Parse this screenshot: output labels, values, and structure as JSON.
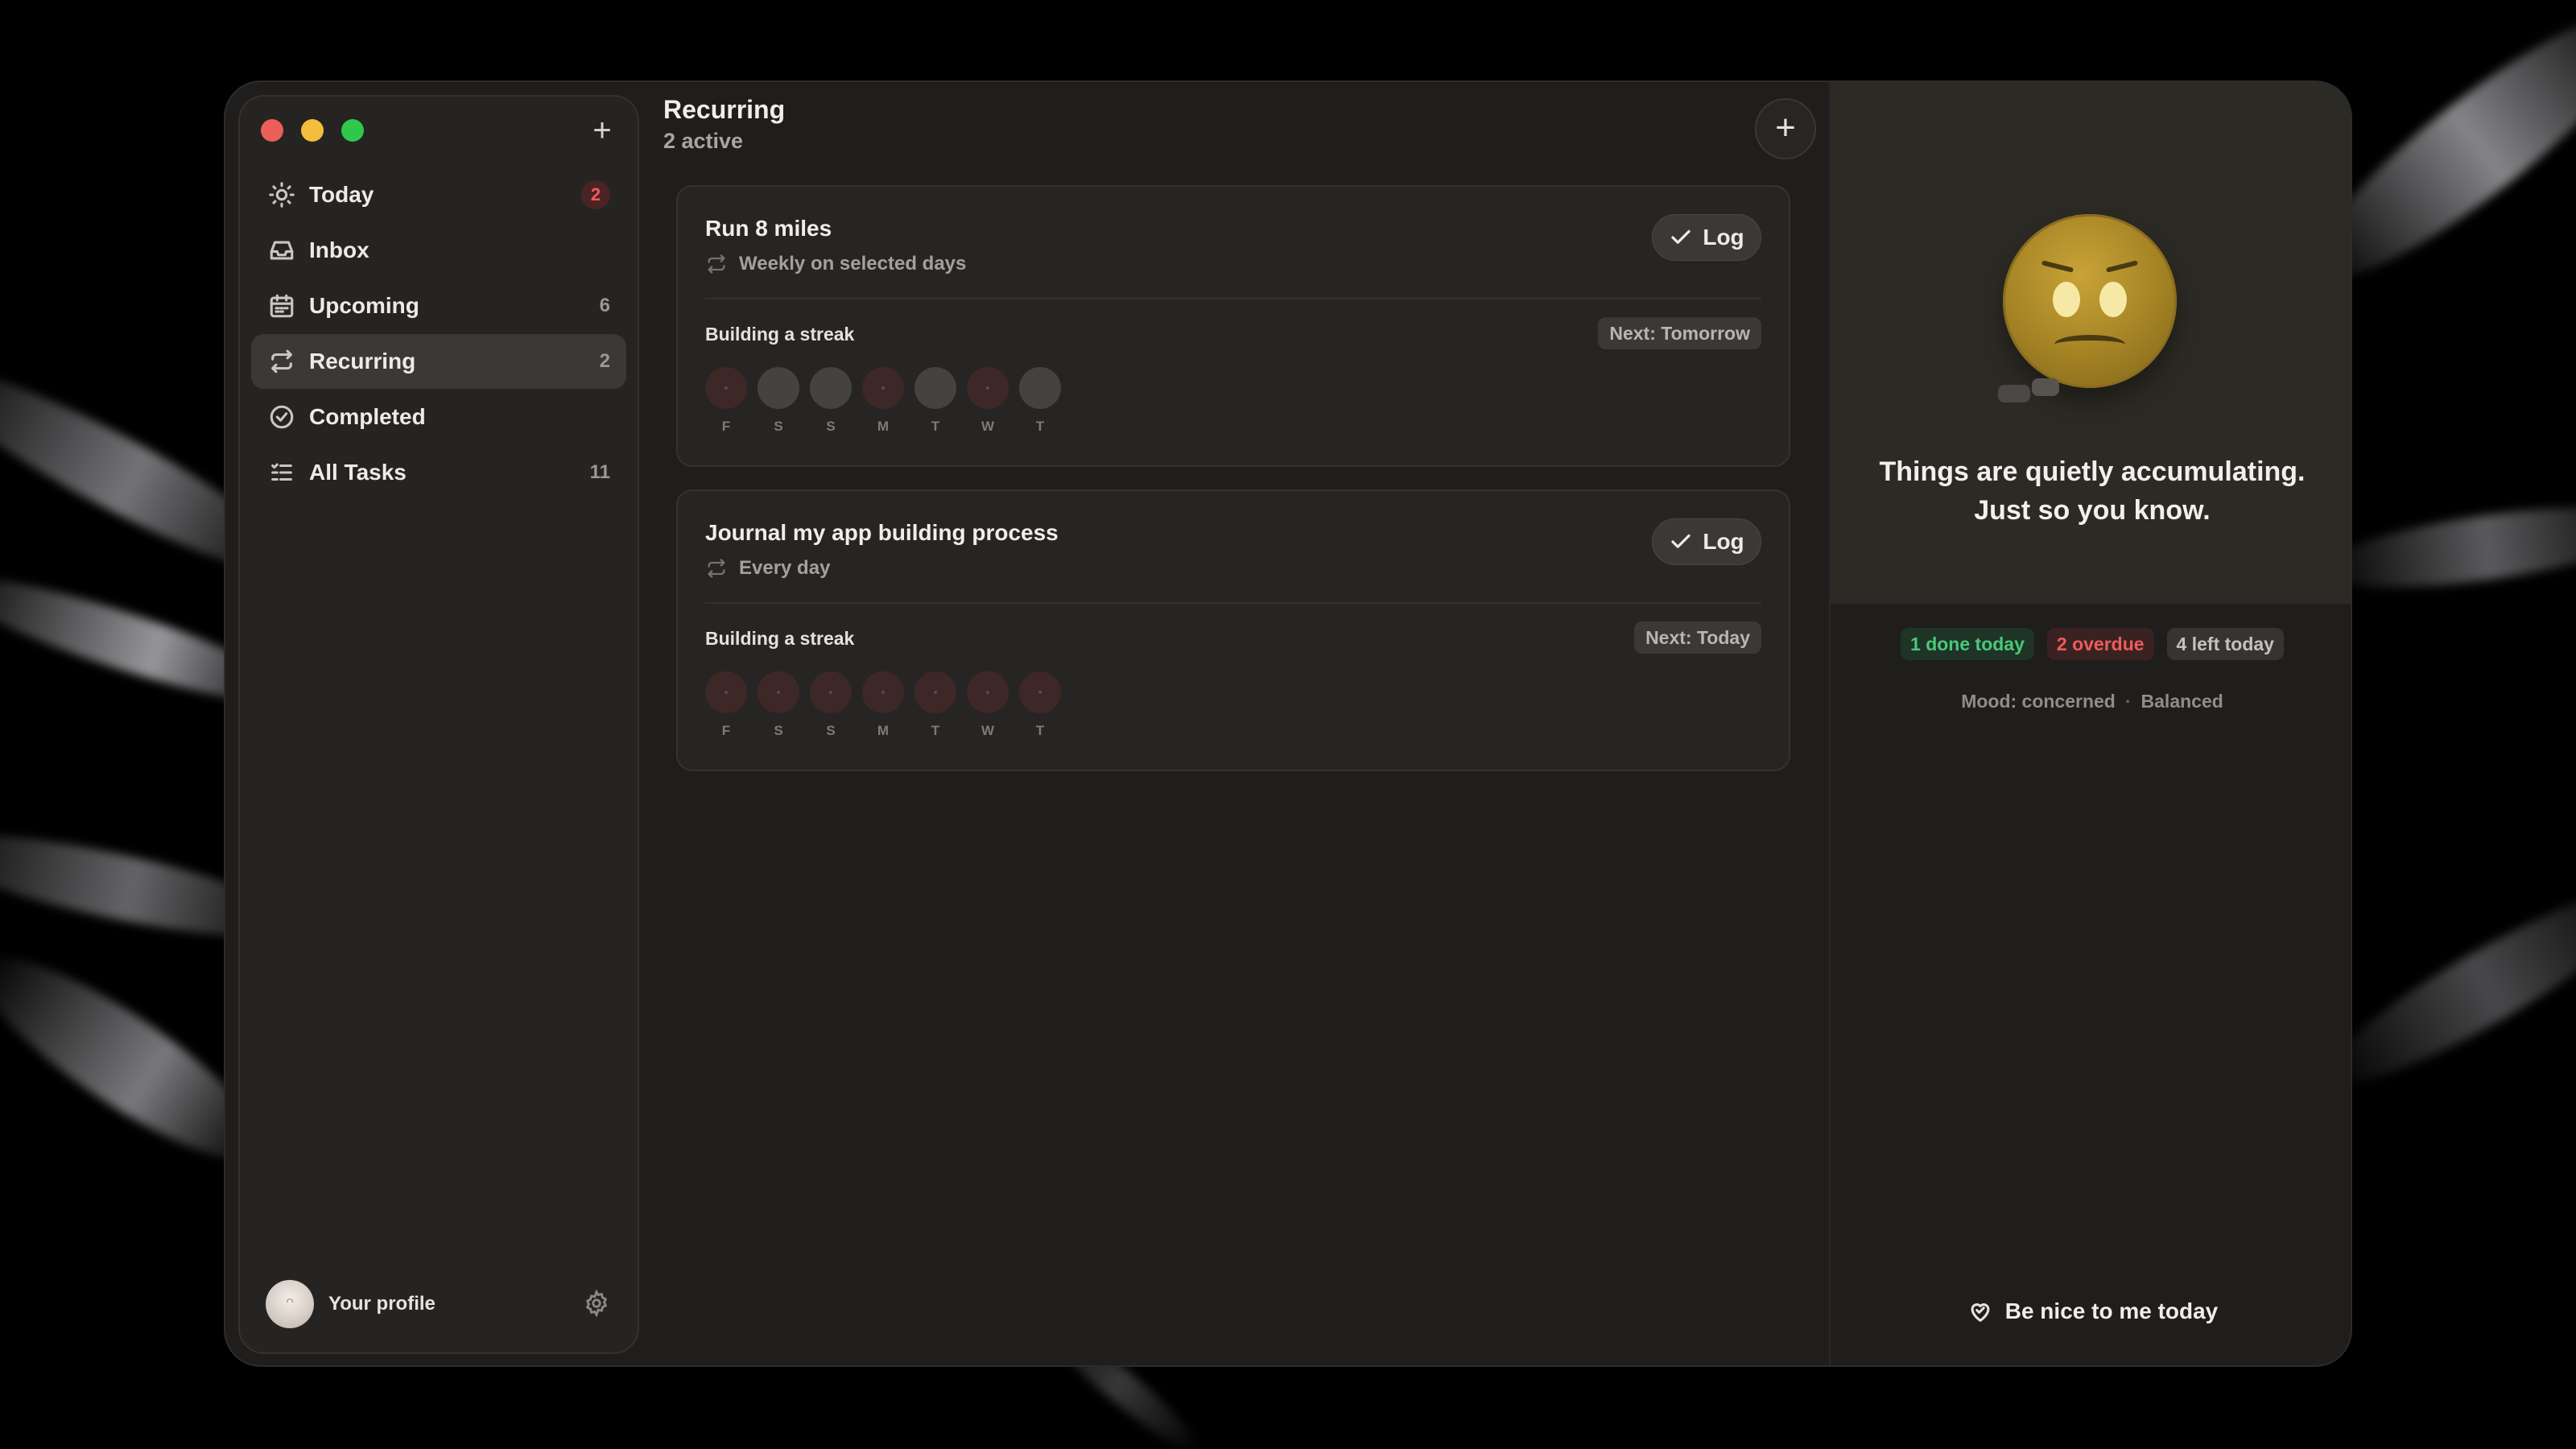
{
  "sidebar": {
    "items": [
      {
        "label": "Today",
        "count": "2",
        "icon": "sun-icon"
      },
      {
        "label": "Inbox",
        "count": "",
        "icon": "inbox-icon"
      },
      {
        "label": "Upcoming",
        "count": "6",
        "icon": "calendar-icon"
      },
      {
        "label": "Recurring",
        "count": "2",
        "icon": "repeat-icon"
      },
      {
        "label": "Completed",
        "count": "",
        "icon": "check-circle-icon"
      },
      {
        "label": "All Tasks",
        "count": "11",
        "icon": "list-icon"
      }
    ],
    "profile_label": "Your profile"
  },
  "main": {
    "title": "Recurring",
    "subtitle": "2 active",
    "cards": [
      {
        "title": "Run 8 miles",
        "recurrence": "Weekly on selected days",
        "log_label": "Log",
        "streak_label": "Building a streak",
        "next": "Next: Tomorrow",
        "days": [
          {
            "letter": "F",
            "state": "missed"
          },
          {
            "letter": "S",
            "state": "empty"
          },
          {
            "letter": "S",
            "state": "empty"
          },
          {
            "letter": "M",
            "state": "missed"
          },
          {
            "letter": "T",
            "state": "empty"
          },
          {
            "letter": "W",
            "state": "missed"
          },
          {
            "letter": "T",
            "state": "empty"
          }
        ]
      },
      {
        "title": "Journal my app building process",
        "recurrence": "Every day",
        "log_label": "Log",
        "streak_label": "Building a streak",
        "next": "Next: Today",
        "days": [
          {
            "letter": "F",
            "state": "missed"
          },
          {
            "letter": "S",
            "state": "missed"
          },
          {
            "letter": "S",
            "state": "missed"
          },
          {
            "letter": "M",
            "state": "missed"
          },
          {
            "letter": "T",
            "state": "missed"
          },
          {
            "letter": "W",
            "state": "missed"
          },
          {
            "letter": "T",
            "state": "missed"
          }
        ]
      }
    ]
  },
  "right": {
    "message_line1": "Things are quietly accumulating.",
    "message_line2": "Just so you know.",
    "stats": {
      "done": "1 done today",
      "overdue": "2 overdue",
      "left": "4 left today"
    },
    "mood": "Mood: concerned",
    "mode": "Balanced",
    "nice_button": "Be nice to me today"
  },
  "colors": {
    "accent_red": "#ef5b5b",
    "accent_green": "#49c979",
    "mood_face": "#a38224"
  }
}
